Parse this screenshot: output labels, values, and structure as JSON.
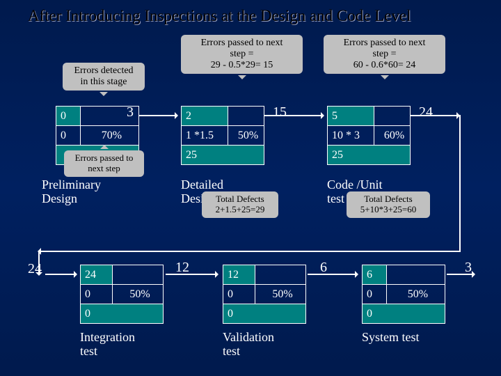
{
  "title": "After Introducing Inspections at the Design and Code Level",
  "callouts": {
    "errors_detected": "Errors detected\nin this stage",
    "errors_passed_to_next": "Errors passed to\nnext step",
    "pass_detailed": "Errors passed to next\nstep =\n29 - 0.5*29= 15",
    "pass_code": "Errors passed to next\nstep =\n60 - 0.6*60= 24",
    "total_defects_detailed": "Total Defects\n2+1.5+25=29",
    "total_defects_code": "Total Defects\n5+10*3+25=60"
  },
  "stages": {
    "prelim": {
      "label": "Preliminary\nDesign",
      "in": "",
      "out": "3",
      "cells": {
        "a": "0",
        "b": "",
        "c": "0",
        "d": "70%",
        "e": ""
      }
    },
    "detailed": {
      "label": "Detailed\nDesign",
      "in": "",
      "out": "15",
      "cells": {
        "a": "2",
        "b": "",
        "c": "1 *1.5",
        "d": "50%",
        "e": "25"
      }
    },
    "code": {
      "label": "Code /Unit\ntest",
      "in": "",
      "out": "24",
      "cells": {
        "a": "5",
        "b": "",
        "c": "10 * 3",
        "d": "60%",
        "e": "25"
      }
    },
    "integration": {
      "label": "Integration\ntest",
      "in": "24",
      "out": "12",
      "cells": {
        "a": "24",
        "b": "",
        "c": "0",
        "d": "50%",
        "e": "0"
      }
    },
    "validation": {
      "label": "Validation\ntest",
      "in": "",
      "out": "6",
      "cells": {
        "a": "12",
        "b": "",
        "c": "0",
        "d": "50%",
        "e": "0"
      }
    },
    "system": {
      "label": "System test",
      "in": "",
      "out": "3",
      "cells": {
        "a": "6",
        "b": "",
        "c": "0",
        "d": "50%",
        "e": "0"
      }
    }
  }
}
